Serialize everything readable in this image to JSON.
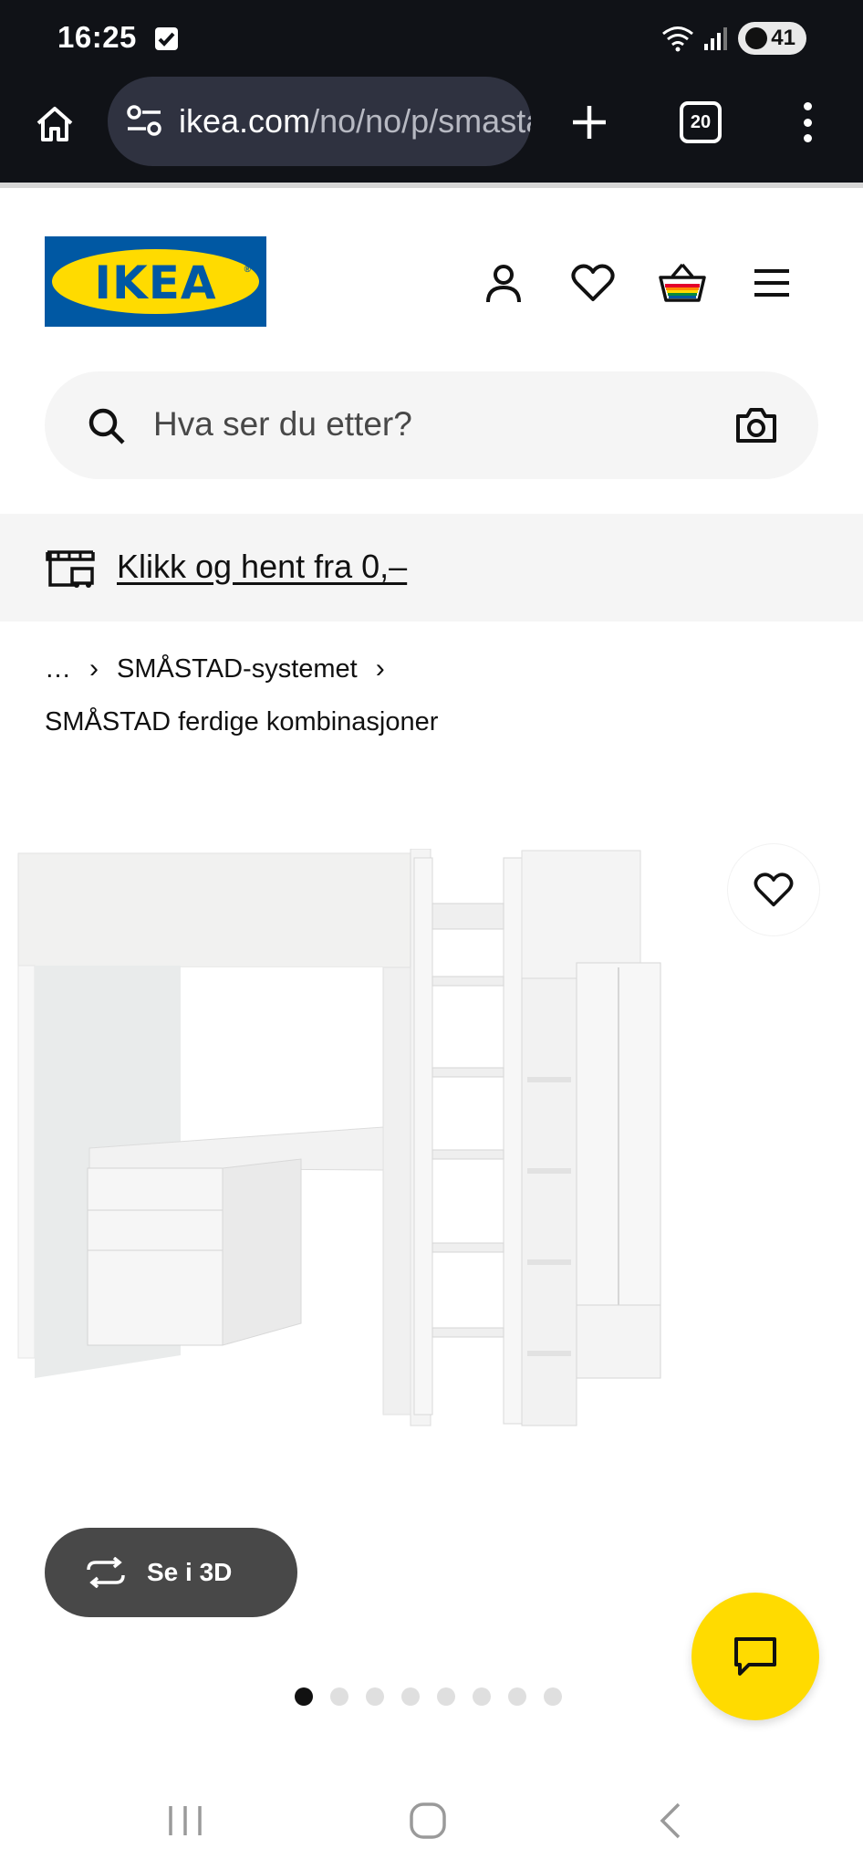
{
  "status_bar": {
    "time": "16:25",
    "battery": "41"
  },
  "browser": {
    "url_host": "ikea.com",
    "url_path": "/no/no/p/smastad",
    "tab_count": "20"
  },
  "header": {
    "logo_text": "IKEA",
    "icons": [
      "user-icon",
      "heart-icon",
      "basket-icon",
      "menu-icon"
    ]
  },
  "search": {
    "placeholder": "Hva ser du etter?"
  },
  "banner": {
    "text": "Klikk og hent fra 0,–"
  },
  "breadcrumb": {
    "ellipsis": "…",
    "parent": "SMÅSTAD-systemet",
    "current": "SMÅSTAD ferdige kombinasjoner"
  },
  "product": {
    "view_3d_label": "Se i 3D",
    "carousel": {
      "count": 8,
      "active_index": 0
    }
  },
  "colors": {
    "ikea_blue": "#0058a3",
    "ikea_yellow": "#ffdb00",
    "browser_dark": "#101217",
    "url_bg": "#2f3240",
    "banner_bg": "#f5f5f5",
    "btn_3d_bg": "#484848"
  }
}
